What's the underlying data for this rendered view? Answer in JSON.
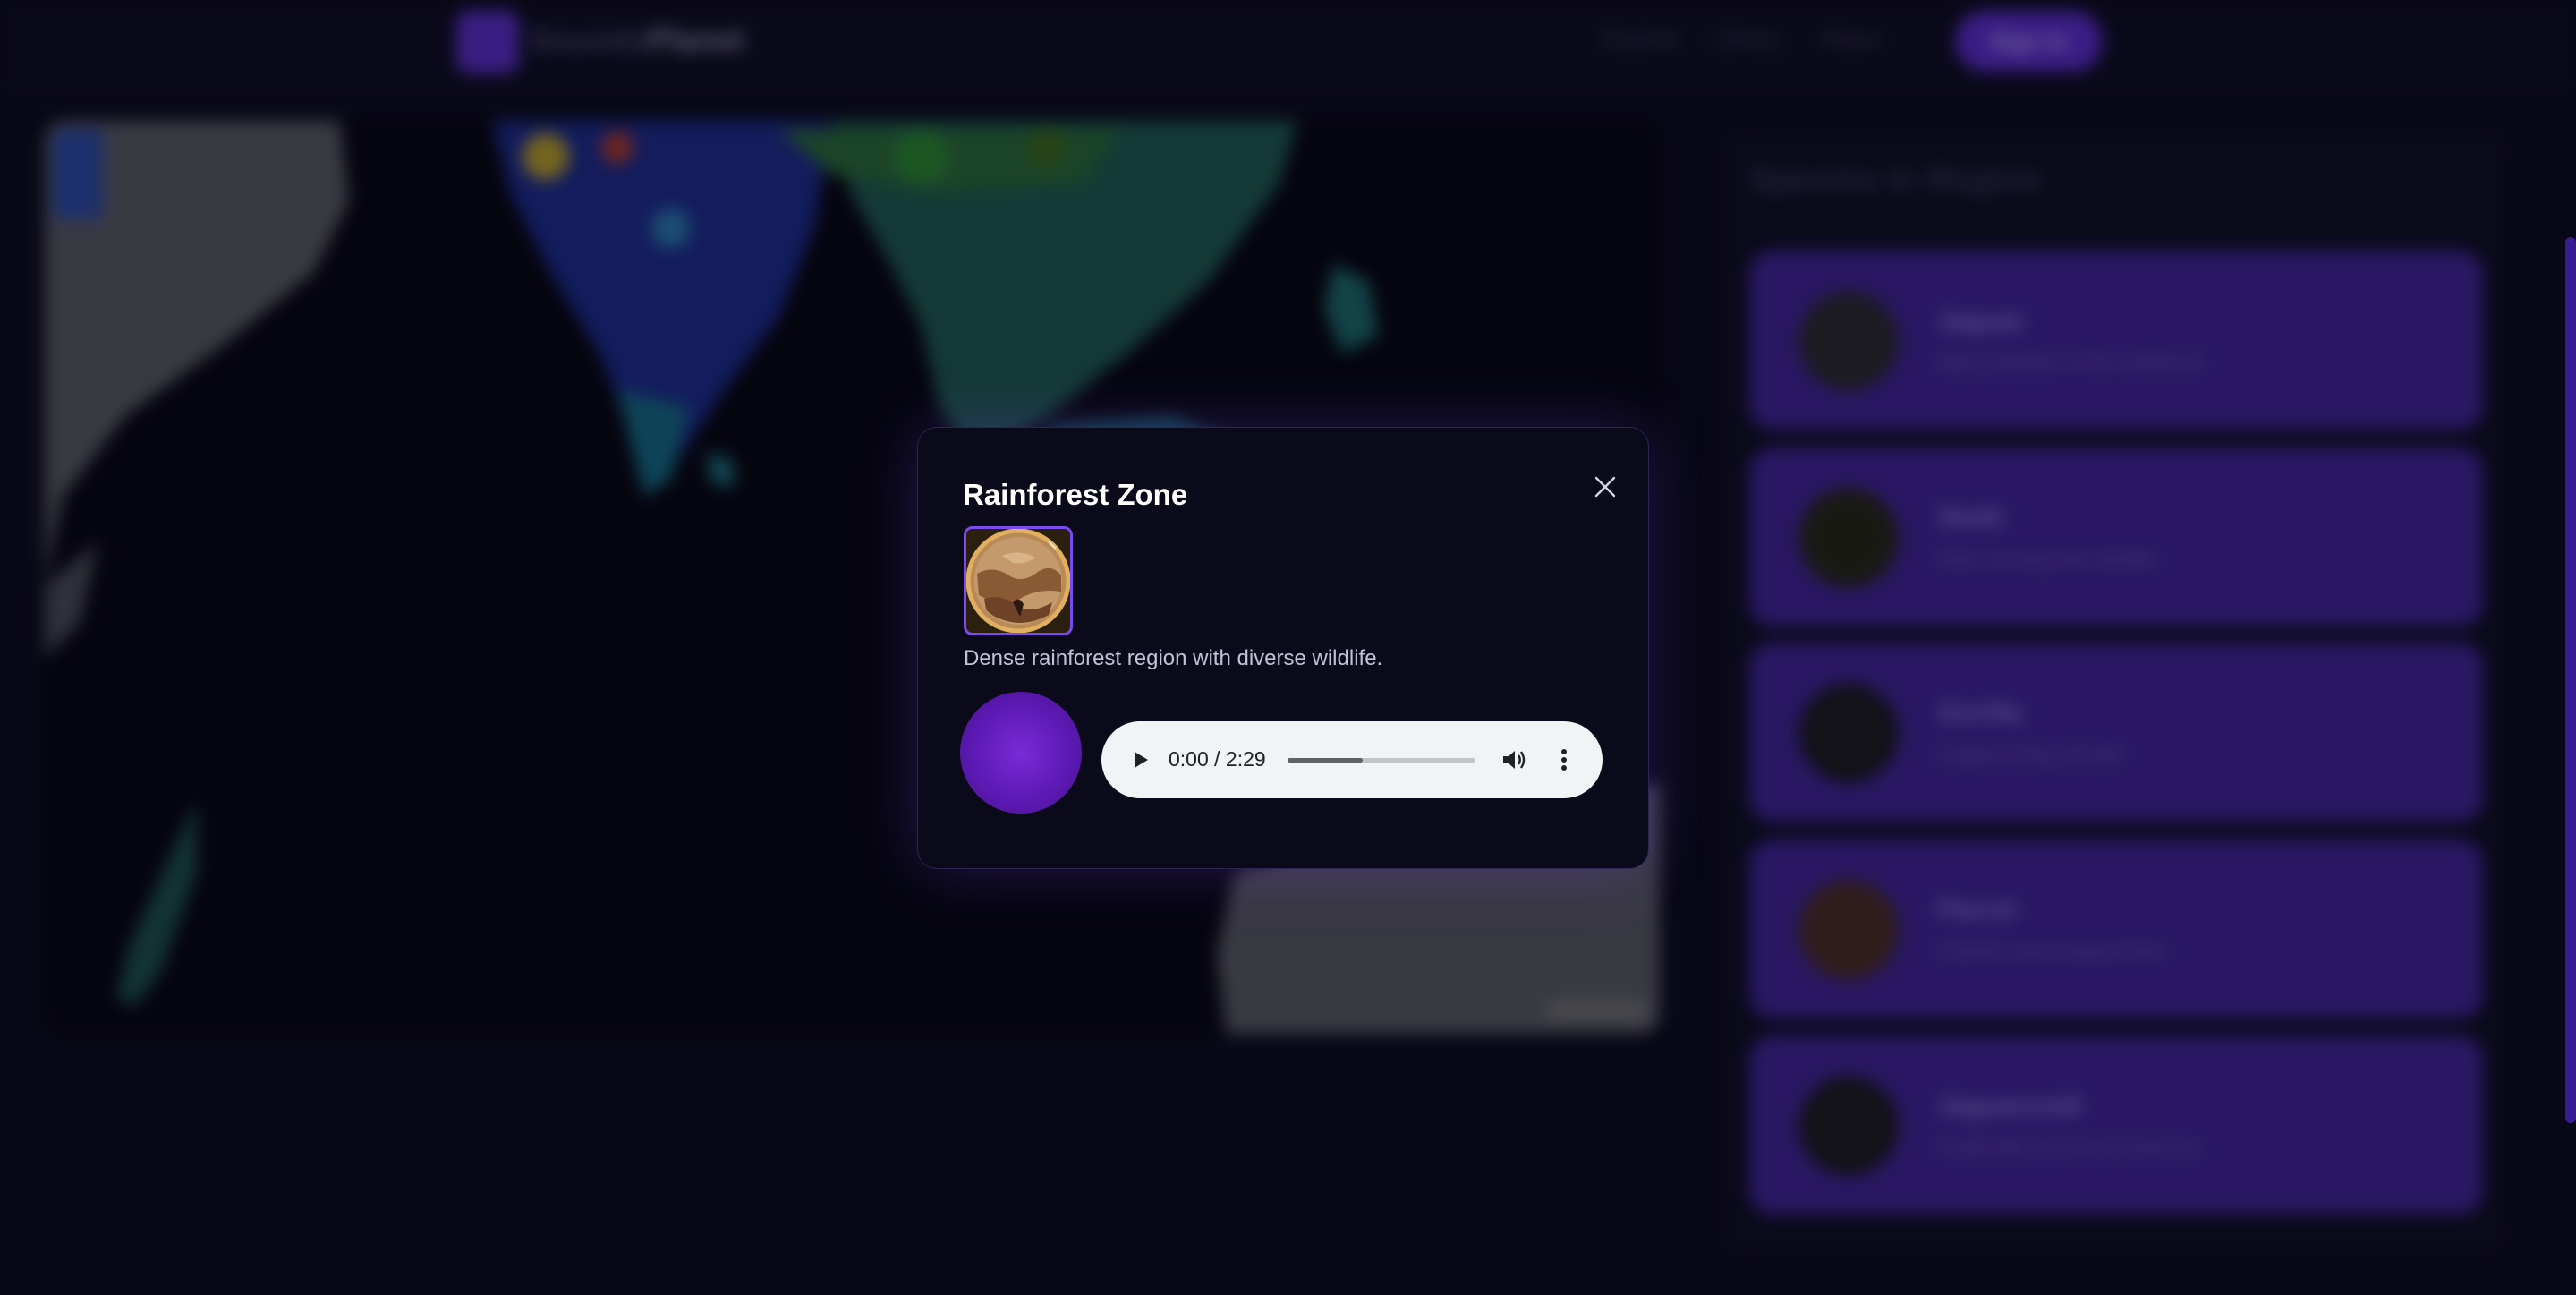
{
  "header": {
    "brand_prefix": "Sounds",
    "brand_suffix": "Planet",
    "nav": [
      "Explore",
      "Library",
      "About"
    ],
    "cta_label": "Sign In"
  },
  "sidebar": {
    "title": "Species in Region",
    "items": [
      {
        "name": "Jaguar",
        "description": "Apex predator of the rainforest"
      },
      {
        "name": "Sloth",
        "description": "Slow-moving tree dweller"
      },
      {
        "name": "Gorilla",
        "description": "Largest living primate"
      },
      {
        "name": "Parrot",
        "description": "Colorful vocal tropical bird"
      },
      {
        "name": "Jaguarundi",
        "description": "Small wild cat of the Americas"
      }
    ]
  },
  "modal": {
    "title": "Rainforest Zone",
    "description": "Dense rainforest region with diverse wildlife.",
    "close_icon": "close-icon",
    "thumbnail_icon": "landscape-thumbnail"
  },
  "audio": {
    "current_time": "0:00",
    "duration": "2:29",
    "time_display": "0:00 / 2:29",
    "progress_fraction": 0.4,
    "icons": [
      "play-icon",
      "volume-icon",
      "more-vertical-icon"
    ]
  },
  "colors": {
    "accent": "#6d3af0",
    "orb": "#6a22c8",
    "modal_bg": "#0b0a1a",
    "player_bg": "#f1f3f4",
    "card_bg": "#3f2396"
  }
}
